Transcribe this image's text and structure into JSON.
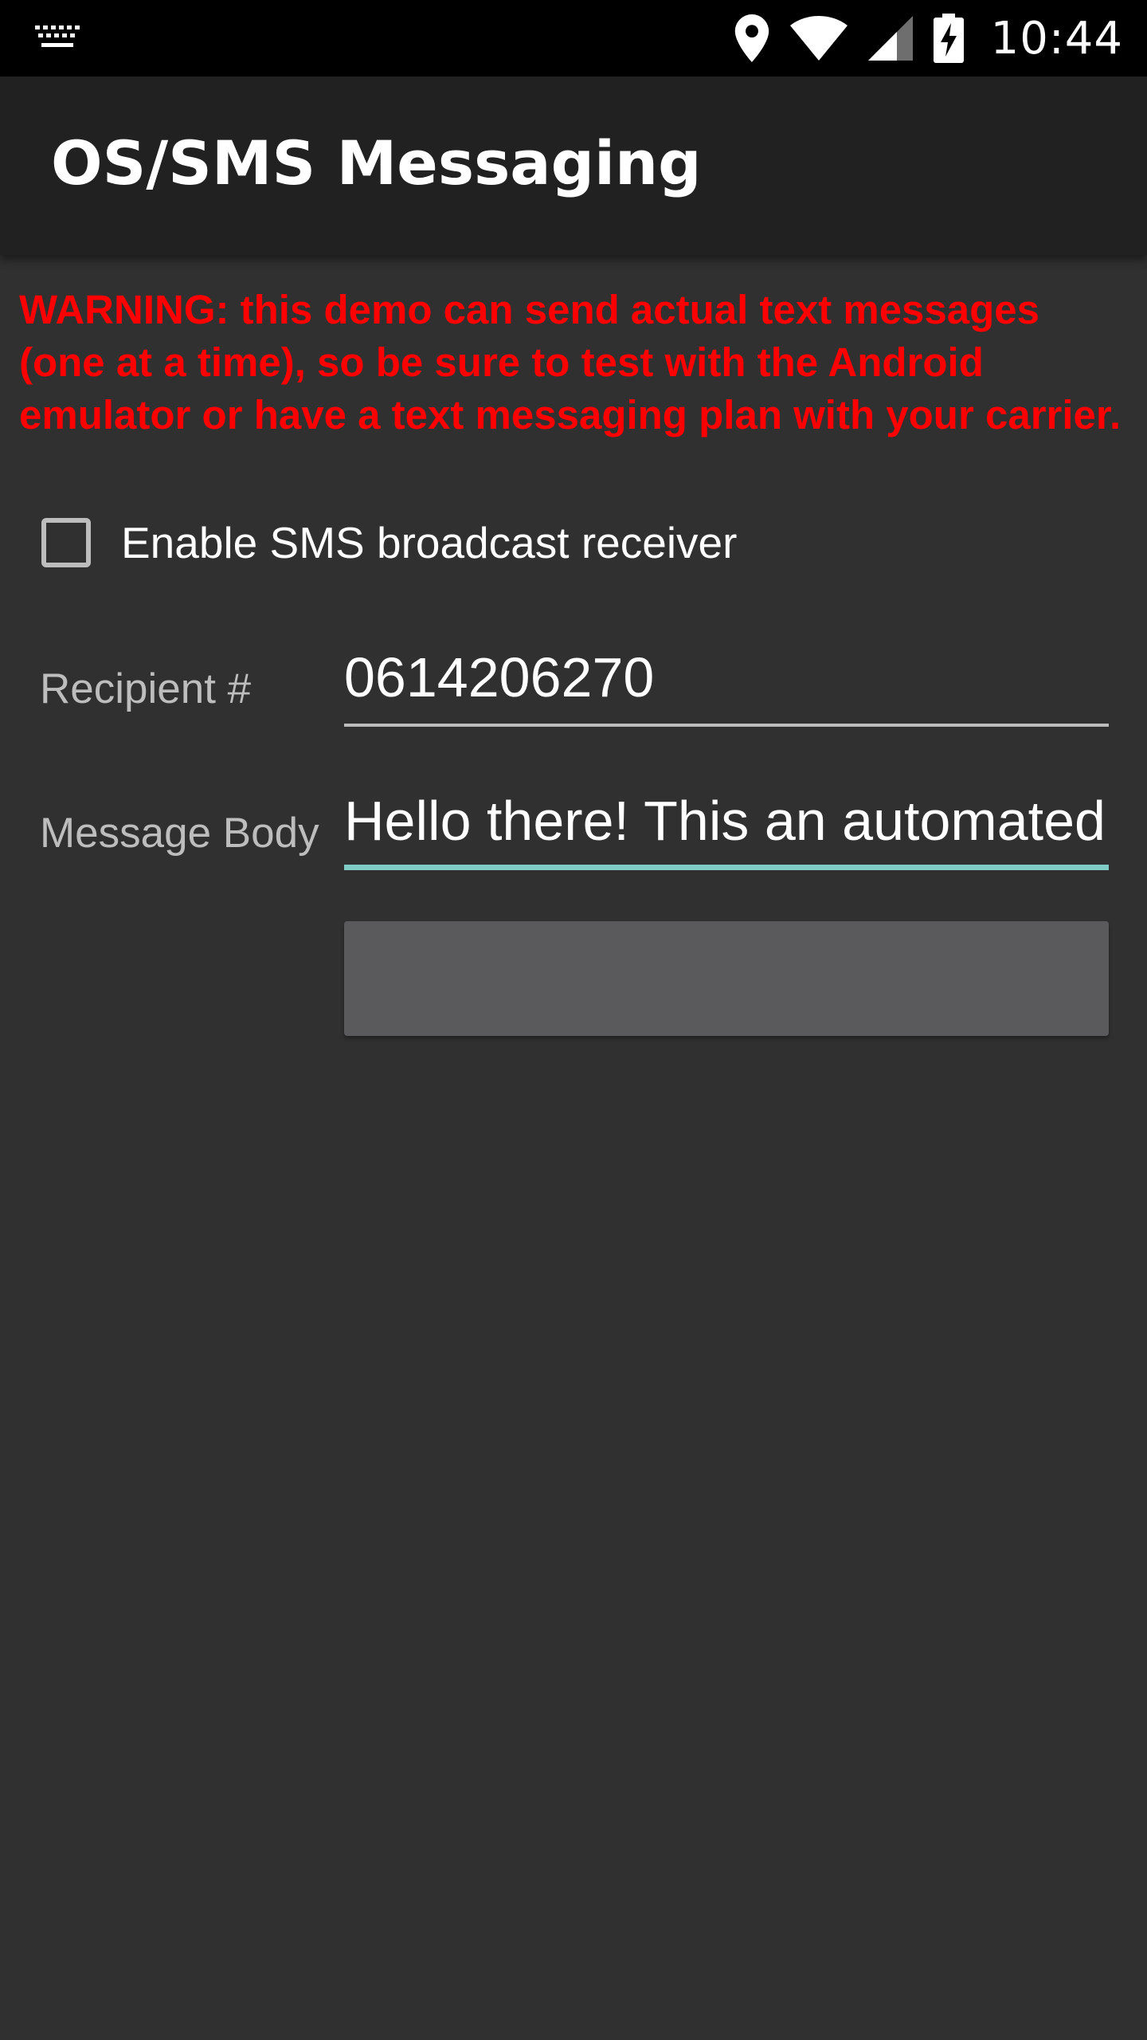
{
  "status_bar": {
    "time": "10:44",
    "icons": [
      "keyboard-icon",
      "location-icon",
      "wifi-icon",
      "cell-signal-icon",
      "battery-charging-icon"
    ]
  },
  "app_bar": {
    "title": "OS/SMS Messaging"
  },
  "content": {
    "warning_text": "WARNING: this demo can send actual text messages (one at a time), so be sure to test with the Android emulator or have a text messaging plan with your carrier.",
    "sms_receiver_checkbox": {
      "label": "Enable SMS broadcast receiver",
      "checked": false
    },
    "recipient": {
      "label": "Recipient #",
      "value": "0614206270"
    },
    "message_body": {
      "label": "Message Body",
      "value": "Hello there! This an automated"
    },
    "send_button": {
      "label": ""
    }
  },
  "colors": {
    "background": "#303030",
    "app_bar": "#212121",
    "status_bar": "#000000",
    "warning": "#ff0000",
    "accent": "#80cbc4",
    "button": "#5a5a5c"
  }
}
